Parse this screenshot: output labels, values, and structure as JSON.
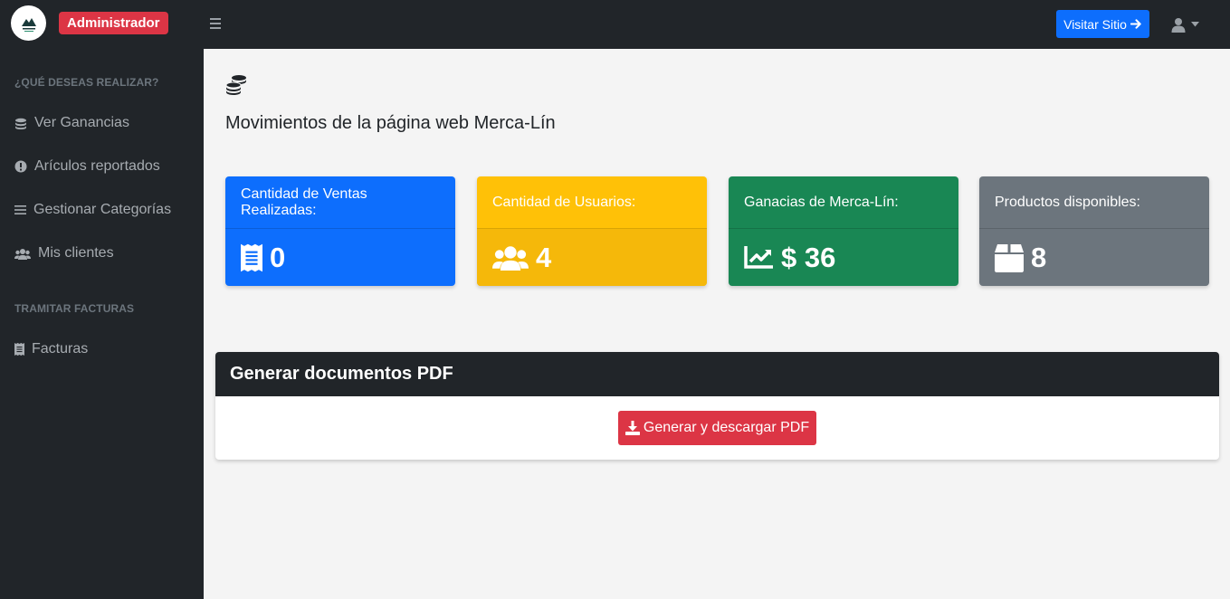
{
  "topbar": {
    "badge": "Administrador",
    "visit_label": "Visitar Sitio",
    "colors": {
      "background": "#212529",
      "badge": "#dc3545",
      "visit_button": "#0d6efd"
    }
  },
  "sidebar": {
    "heading_actions": "¿QUÉ DESEAS REALIZAR?",
    "items": [
      {
        "label": "Ver Ganancias",
        "icon": "coins-icon"
      },
      {
        "label": "Arículos reportados",
        "icon": "exclamation-circle-icon"
      },
      {
        "label": "Gestionar Categorías",
        "icon": "bars-icon"
      },
      {
        "label": "Mis clientes",
        "icon": "users-icon"
      }
    ],
    "heading_invoices": "TRAMITAR FACTURAS",
    "invoice_items": [
      {
        "label": "Facturas",
        "icon": "receipt-icon"
      }
    ]
  },
  "main": {
    "title": "Movimientos de la página web Merca-Lín",
    "cards": [
      {
        "title": "Cantidad de Ventas Realizadas:",
        "value": "0",
        "icon": "receipt-icon",
        "color": "#0d6efd"
      },
      {
        "title": "Cantidad de Usuarios:",
        "value": "4",
        "icon": "users-icon",
        "color": "#ffc107"
      },
      {
        "title": "Ganacias de Merca-Lín:",
        "value": "$ 36",
        "icon": "chart-line-icon",
        "color": "#198754"
      },
      {
        "title": "Productos disponibles:",
        "value": "8",
        "icon": "box-icon",
        "color": "#6c757d"
      }
    ],
    "pdf": {
      "title": "Generar documentos PDF",
      "button_label": "Generar y descargar PDF",
      "button_color": "#dc3545"
    }
  }
}
